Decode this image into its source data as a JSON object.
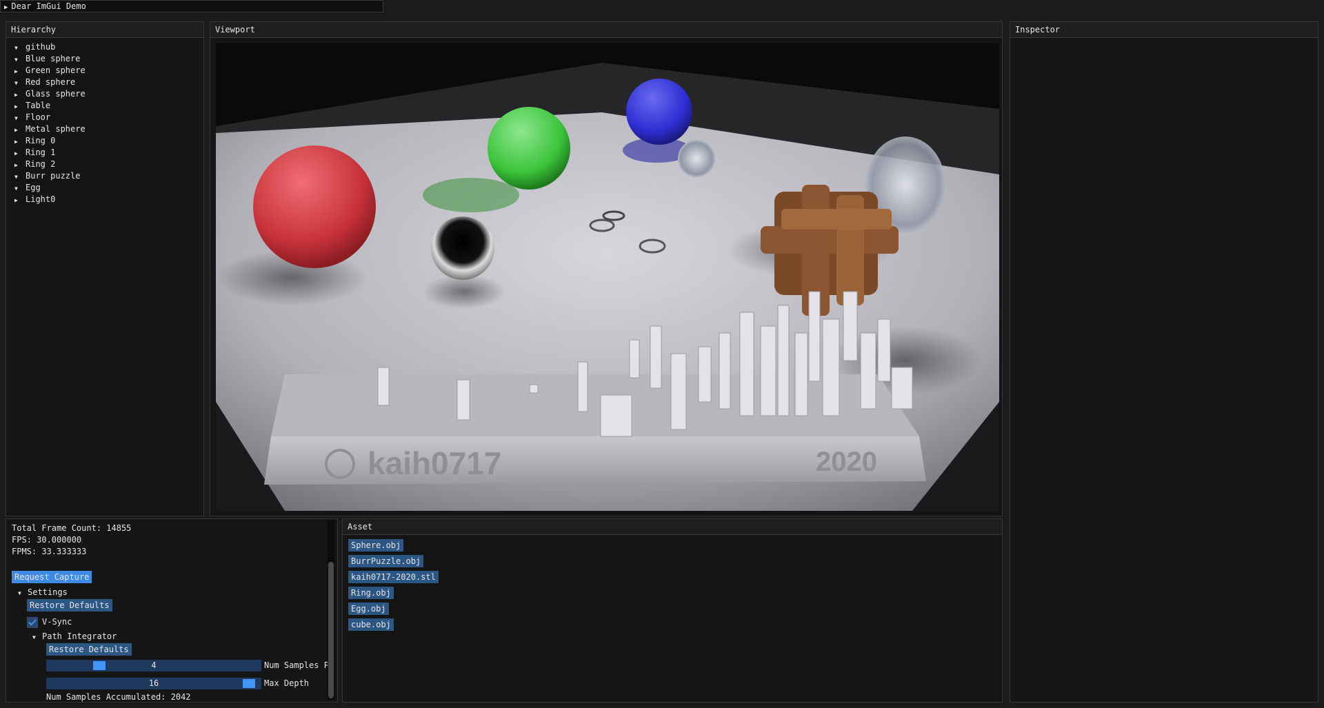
{
  "demo_window": {
    "title": "Dear ImGui Demo"
  },
  "hierarchy": {
    "title": "Hierarchy",
    "items": [
      {
        "label": "github",
        "expanded": true
      },
      {
        "label": "Blue sphere",
        "expanded": true
      },
      {
        "label": "Green sphere",
        "expanded": false
      },
      {
        "label": "Red sphere",
        "expanded": true
      },
      {
        "label": "Glass sphere",
        "expanded": false
      },
      {
        "label": "Table",
        "expanded": false
      },
      {
        "label": "Floor",
        "expanded": true
      },
      {
        "label": "Metal sphere",
        "expanded": false
      },
      {
        "label": "Ring 0",
        "expanded": false
      },
      {
        "label": "Ring 1",
        "expanded": false
      },
      {
        "label": "Ring 2",
        "expanded": false
      },
      {
        "label": "Burr puzzle",
        "expanded": true
      },
      {
        "label": "Egg",
        "expanded": true
      },
      {
        "label": "Light0",
        "expanded": false
      }
    ]
  },
  "viewport": {
    "title": "Viewport",
    "render": {
      "engraving_text": "kaih0717",
      "engraving_year": "2020"
    }
  },
  "inspector": {
    "title": "Inspector"
  },
  "stats": {
    "total_frame_count": "Total Frame Count: 14855",
    "fps": "FPS: 30.000000",
    "fpms": "FPMS: 33.333333",
    "request_capture_label": "Request Capture",
    "settings_label": "Settings",
    "restore_defaults_label": "Restore Defaults",
    "vsync_label": "V-Sync",
    "vsync_checked": true,
    "path_integrator_label": "Path Integrator",
    "path_restore_defaults_label": "Restore Defaults",
    "num_samples": {
      "value": "4",
      "label": "Num Samples Pe",
      "fraction": 0.23
    },
    "max_depth": {
      "value": "16",
      "label": "Max Depth",
      "fraction": 0.97
    },
    "num_samples_accumulated": "Num Samples Accumulated: 2042"
  },
  "asset": {
    "title": "Asset",
    "items": [
      "Sphere.obj",
      "BurrPuzzle.obj",
      "kaih0717-2020.stl",
      "Ring.obj",
      "Egg.obj",
      "cube.obj"
    ]
  },
  "colors": {
    "button": "#2c5684",
    "button_active": "#3f8ae6",
    "slider_bg": "#1f3a5e",
    "slider_grab": "#4296fa",
    "window_bg": "#141414"
  }
}
